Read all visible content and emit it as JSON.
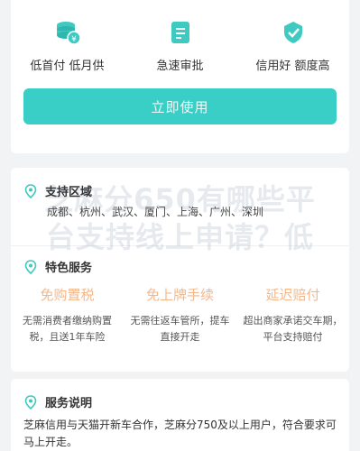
{
  "features": [
    {
      "icon": "coins-icon",
      "label": "低首付 低月供"
    },
    {
      "icon": "document-icon",
      "label": "急速审批"
    },
    {
      "icon": "shield-check-icon",
      "label": "信用好 额度高"
    }
  ],
  "apply_button": "立即使用",
  "support": {
    "icon": "location-pin-icon",
    "title": "支持区域",
    "line": "成都、杭州、武汉、厦门、上海、广州、深圳"
  },
  "brand": {
    "icon": "location-pin-icon",
    "title": "特色服务",
    "services": [
      {
        "title": "免购置税",
        "desc": "无需消费者缴纳购置税，且送1年车险"
      },
      {
        "title": "免上牌手续",
        "desc": "无需往返车管所，提车直接开走"
      },
      {
        "title": "延迟赔付",
        "desc": "超出商家承诺交车期，平台支持赔付"
      }
    ]
  },
  "description": {
    "icon": "location-pin-icon",
    "title": "服务说明",
    "text": "芝麻信用与天猫开新车合作，芝麻分750及以上用户，符合要求可马上开走。"
  },
  "watermark": {
    "line1": "芝麻分650有哪些平",
    "line2": "台支持线上申请？低"
  },
  "colors": {
    "accent": "#39cfc6",
    "service_orange": "#f0a064"
  }
}
